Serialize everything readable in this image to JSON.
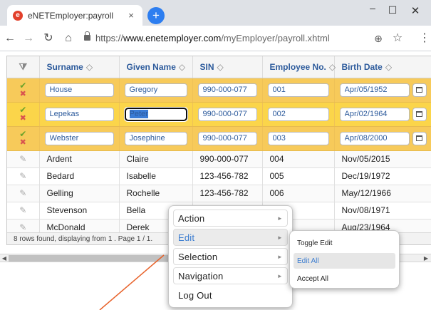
{
  "browser": {
    "tab_title": "eNETEmployer:payroll",
    "tab_favicon_glyph": "e",
    "tab_close": "×",
    "new_tab": "+",
    "url_scheme": "https://",
    "url_host": "www.enetemployer.com",
    "url_path": "/myEmployer/payroll.xhtml",
    "window_min": "–",
    "window_max": "☐",
    "window_close": "✕",
    "icons": [
      "back-icon",
      "forward-icon",
      "reload-icon",
      "home-icon",
      "lock-icon",
      "zoom-icon",
      "star-icon",
      "menu-icon"
    ]
  },
  "grid": {
    "columns": [
      {
        "label": "Surname",
        "sort": "◇"
      },
      {
        "label": "Given Name",
        "sort": "◇"
      },
      {
        "label": "SIN",
        "sort": "◇"
      },
      {
        "label": "Employee No.",
        "sort": "◇"
      },
      {
        "label": "Birth Date",
        "sort": "◇"
      }
    ],
    "editing_rows": [
      {
        "surname": "House",
        "given": "Gregory",
        "sin": "990-000-077",
        "emp": "001",
        "birth": "Apr/05/1952"
      },
      {
        "surname": "Lepekas",
        "given": "Peter",
        "sin": "990-000-077",
        "emp": "002",
        "birth": "Apr/02/1964"
      },
      {
        "surname": "Webster",
        "given": "Josephine",
        "sin": "990-000-077",
        "emp": "003",
        "birth": "Apr/08/2000"
      }
    ],
    "rows": [
      {
        "surname": "Ardent",
        "given": "Claire",
        "sin": "990-000-077",
        "emp": "004",
        "birth": "Nov/05/2015"
      },
      {
        "surname": "Bedard",
        "given": "Isabelle",
        "sin": "123-456-782",
        "emp": "005",
        "birth": "Dec/19/1972"
      },
      {
        "surname": "Gelling",
        "given": "Rochelle",
        "sin": "123-456-782",
        "emp": "006",
        "birth": "May/12/1966"
      },
      {
        "surname": "Stevenson",
        "given": "Bella",
        "sin": "",
        "emp": "",
        "birth": "Nov/08/1971"
      },
      {
        "surname": "McDonald",
        "given": "Derek",
        "sin": "",
        "emp": "",
        "birth": "Aug/23/1964"
      }
    ],
    "paginator": "8 rows found, displaying from 1 . Page 1 / 1.",
    "colors": {
      "edit_row": "#f7ca5a",
      "header_text": "#2d5b9c",
      "check": "#6aa22a",
      "cross": "#d9534f"
    }
  },
  "context_menu": {
    "items": [
      {
        "label": "Action",
        "arrow": "►"
      },
      {
        "label": "Edit",
        "arrow": "►"
      },
      {
        "label": "Selection",
        "arrow": "►"
      },
      {
        "label": "Navigation",
        "arrow": "►"
      },
      {
        "label": "Log Out",
        "arrow": ""
      }
    ],
    "submenu": [
      {
        "label": "Toggle Edit"
      },
      {
        "label": "Edit All"
      },
      {
        "label": "Accept All"
      }
    ]
  }
}
